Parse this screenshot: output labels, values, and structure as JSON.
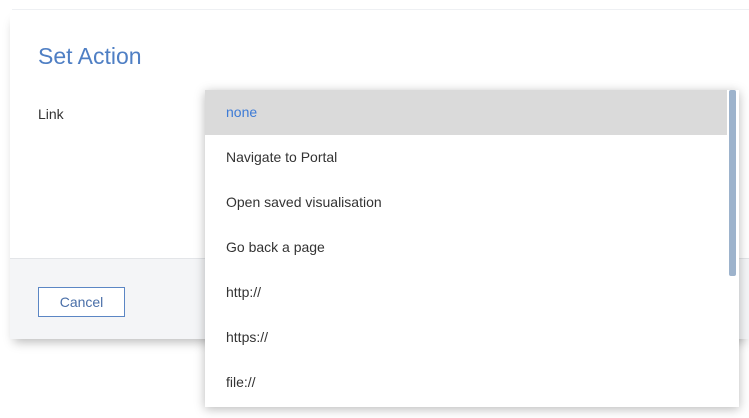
{
  "dialog": {
    "title": "Set Action",
    "link_label": "Link"
  },
  "footer": {
    "cancel_label": "Cancel"
  },
  "dropdown": {
    "selected": "none",
    "options": [
      "none",
      "Navigate to Portal",
      "Open saved visualisation",
      "Go back a page",
      "http://",
      "https://",
      "file://"
    ],
    "scroll_fraction_visible": 0.59
  },
  "colors": {
    "accent": "#4f7fc4",
    "selected_text": "#3d7bd6",
    "selected_background": "#dadada",
    "scrollbar_thumb": "#9db3cc"
  }
}
